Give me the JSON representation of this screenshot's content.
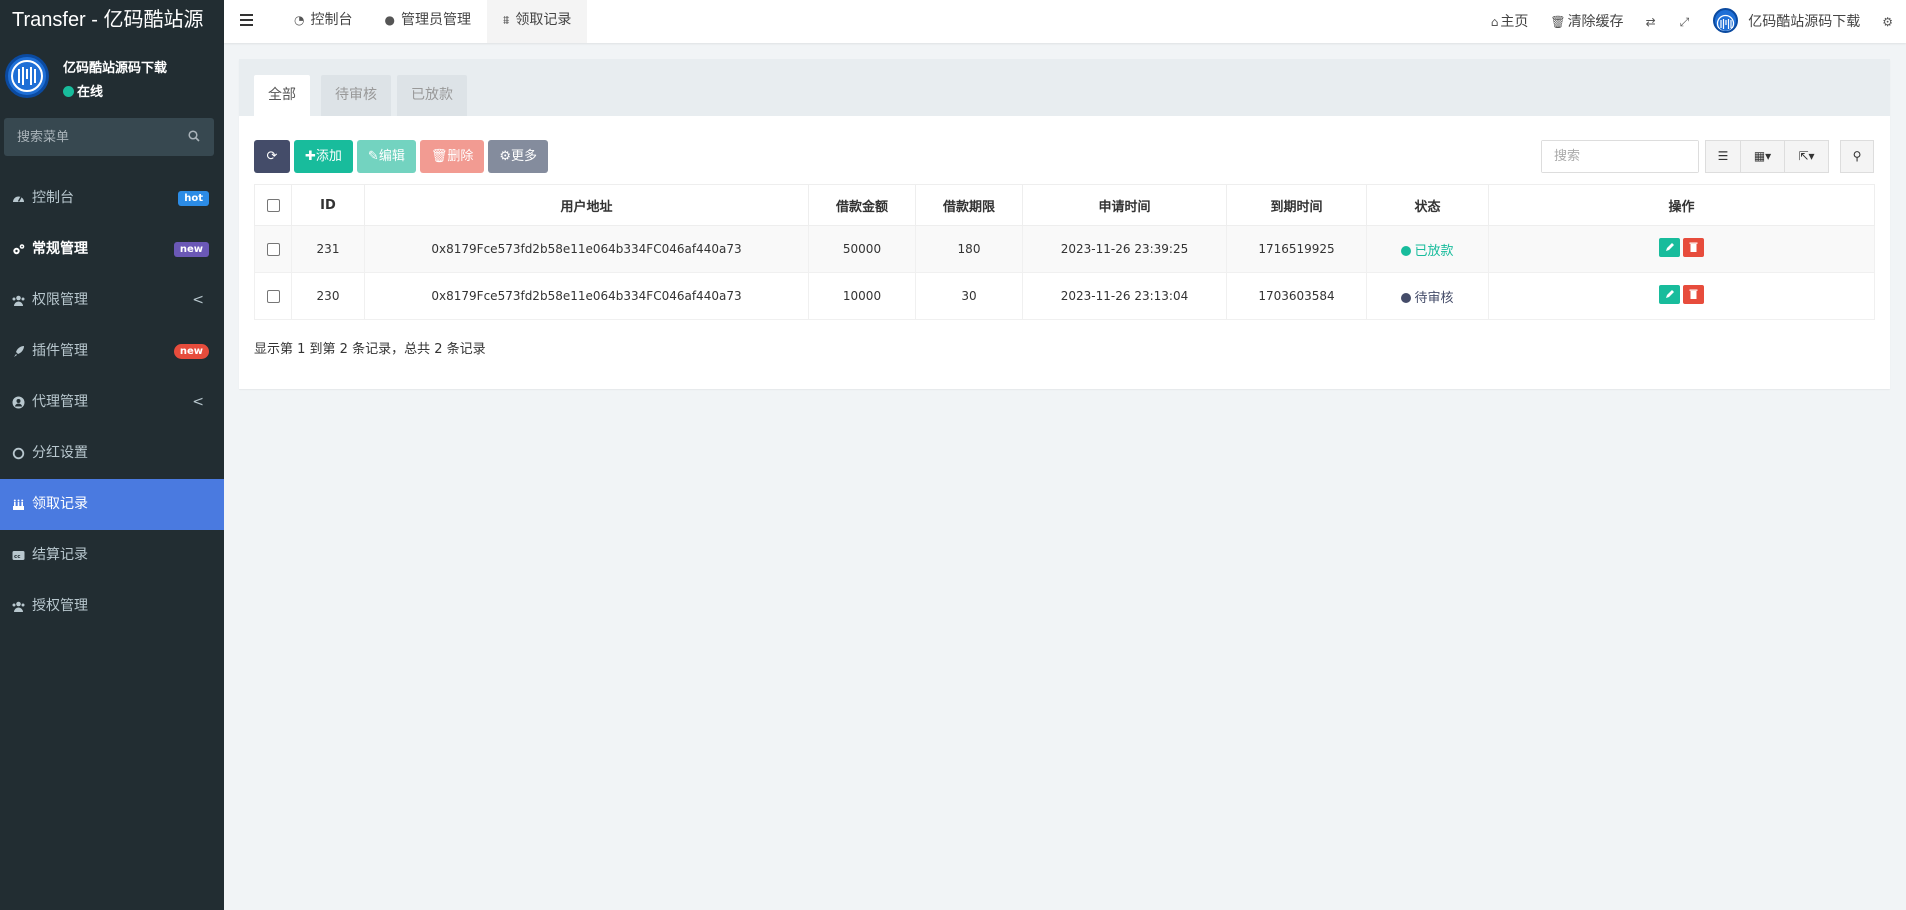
{
  "app": {
    "title": "Transfer - 亿码酷站源"
  },
  "user": {
    "name": "亿码酷站源码下载",
    "status": "在线"
  },
  "sidebar": {
    "search_placeholder": "搜索菜单",
    "items": [
      {
        "label": "控制台",
        "icon": "dashboard-icon",
        "badge": "hot"
      },
      {
        "label": "常规管理",
        "icon": "cogs-icon",
        "badge": "new"
      },
      {
        "label": "权限管理",
        "icon": "group-icon",
        "chevron": "<"
      },
      {
        "label": "插件管理",
        "icon": "rocket-icon",
        "badge": "new"
      },
      {
        "label": "代理管理",
        "icon": "user-circle-icon",
        "chevron": "<"
      },
      {
        "label": "分红设置",
        "icon": "circle-icon"
      },
      {
        "label": "领取记录",
        "icon": "birthday-cake-icon",
        "active": true
      },
      {
        "label": "结算记录",
        "icon": "cc-icon"
      },
      {
        "label": "授权管理",
        "icon": "users-icon"
      }
    ]
  },
  "topnav": {
    "tabs": [
      {
        "label": "控制台",
        "icon": "dashboard-icon"
      },
      {
        "label": "管理员管理",
        "icon": "user-icon"
      },
      {
        "label": "领取记录",
        "icon": "birthday-cake-icon",
        "active": true
      }
    ],
    "home": "主页",
    "clear_cache": "清除缓存",
    "admin_name": "亿码酷站源码下载"
  },
  "page": {
    "tabs": [
      "全部",
      "待审核",
      "已放款"
    ],
    "toolbar": {
      "add": "添加",
      "edit": "编辑",
      "delete": "删除",
      "more": "更多"
    },
    "search_placeholder": "搜索",
    "table": {
      "columns": [
        "ID",
        "用户地址",
        "借款金额",
        "借款期限",
        "申请时间",
        "到期时间",
        "状态",
        "操作"
      ],
      "rows": [
        {
          "id": "231",
          "address": "0x8179Fce573fd2b58e11e064b334FC046af440a73",
          "amount": "50000",
          "term": "180",
          "apply_time": "2023-11-26 23:39:25",
          "expire_time": "1716519925",
          "status": "已放款",
          "status_color": "#18bc9c"
        },
        {
          "id": "230",
          "address": "0x8179Fce573fd2b58e11e064b334FC046af440a73",
          "amount": "10000",
          "term": "30",
          "apply_time": "2023-11-26 23:13:04",
          "expire_time": "1703603584",
          "status": "待审核",
          "status_color": "#444c69"
        }
      ]
    },
    "pagination_text": "显示第 1 到第 2 条记录，总共 2 条记录"
  },
  "colors": {
    "sidebar_bg": "#222d32",
    "active": "#4a7ae0",
    "success": "#18bc9c",
    "danger": "#e74c3c"
  }
}
